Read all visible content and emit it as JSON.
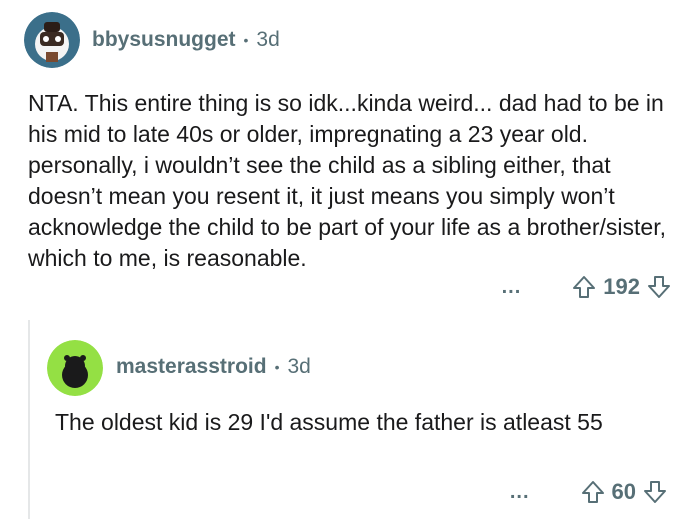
{
  "comments": [
    {
      "username": "bbysusnugget",
      "time": "3d",
      "text": "NTA. This entire thing is so idk...kinda weird... dad had to be in his mid to late 40s or older, impregnating a 23 year old. personally, i wouldn’t see the child as a sibling either, that doesn’t mean you resent it, it just means you simply won’t acknowledge the child to be part of your life as a brother/sister, which to me, is reasonable.",
      "score": "192",
      "more": "..."
    },
    {
      "username": "masterasstroid",
      "time": "3d",
      "text": "The oldest kid is 29 I'd assume the father is atleast 55",
      "score": "60",
      "more": "..."
    }
  ],
  "separator": "•",
  "colors": {
    "meta": "#576f76",
    "text": "#1a1a1b",
    "avatar2_bg": "#94e044",
    "thread_line": "#e5e7e8"
  },
  "icons": {
    "upvote": "upvote-arrow-icon",
    "downvote": "downvote-arrow-icon",
    "more": "more-options-icon"
  }
}
